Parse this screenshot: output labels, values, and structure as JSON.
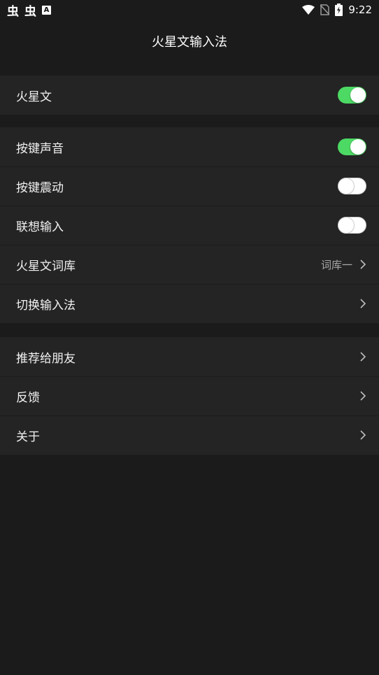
{
  "status_bar": {
    "left_icons": [
      "bug-icon",
      "bug-icon",
      "a-icon"
    ],
    "app_glyph_1": "虫",
    "app_glyph_2": "虫",
    "a_badge": "A",
    "right_icons": [
      "wifi-icon",
      "no-sim-icon",
      "battery-charging-icon"
    ],
    "time": "9:22"
  },
  "header": {
    "title": "火星文输入法"
  },
  "groups": [
    {
      "rows": [
        {
          "label": "火星文",
          "control": "toggle",
          "on": true
        }
      ]
    },
    {
      "rows": [
        {
          "label": "按键声音",
          "control": "toggle",
          "on": true
        },
        {
          "label": "按键震动",
          "control": "toggle",
          "on": false
        },
        {
          "label": "联想输入",
          "control": "toggle",
          "on": false
        },
        {
          "label": "火星文词库",
          "control": "chevron",
          "value": "词库一"
        },
        {
          "label": "切换输入法",
          "control": "chevron"
        }
      ]
    },
    {
      "rows": [
        {
          "label": "推荐给朋友",
          "control": "chevron"
        },
        {
          "label": "反馈",
          "control": "chevron"
        },
        {
          "label": "关于",
          "control": "chevron"
        }
      ]
    }
  ],
  "colors": {
    "background": "#1b1b1b",
    "row_background": "#242424",
    "toggle_on": "#4cd964",
    "secondary_text": "#a9a9a9"
  }
}
